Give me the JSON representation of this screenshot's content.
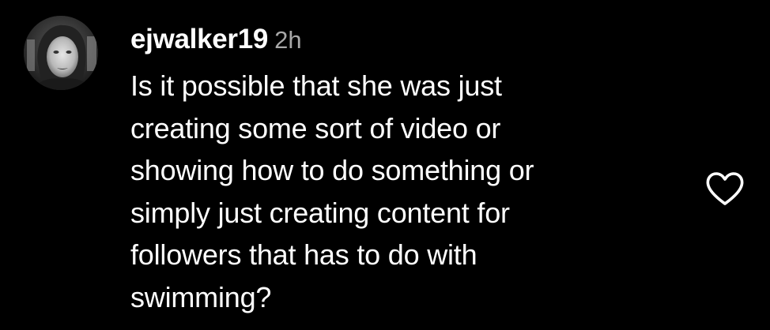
{
  "comment": {
    "username": "ejwalker19",
    "timestamp": "2h",
    "text_lines": [
      "Is it possible that she was just",
      "creating some sort of video or",
      "showing how to do something or",
      "simply just creating content for",
      "followers that has to do with",
      "swimming?"
    ],
    "avatar_icon": "user-avatar",
    "like_icon": "heart-outline-icon"
  },
  "colors": {
    "background": "#000000",
    "text_primary": "#ffffff",
    "text_secondary": "#a8a8a8"
  }
}
